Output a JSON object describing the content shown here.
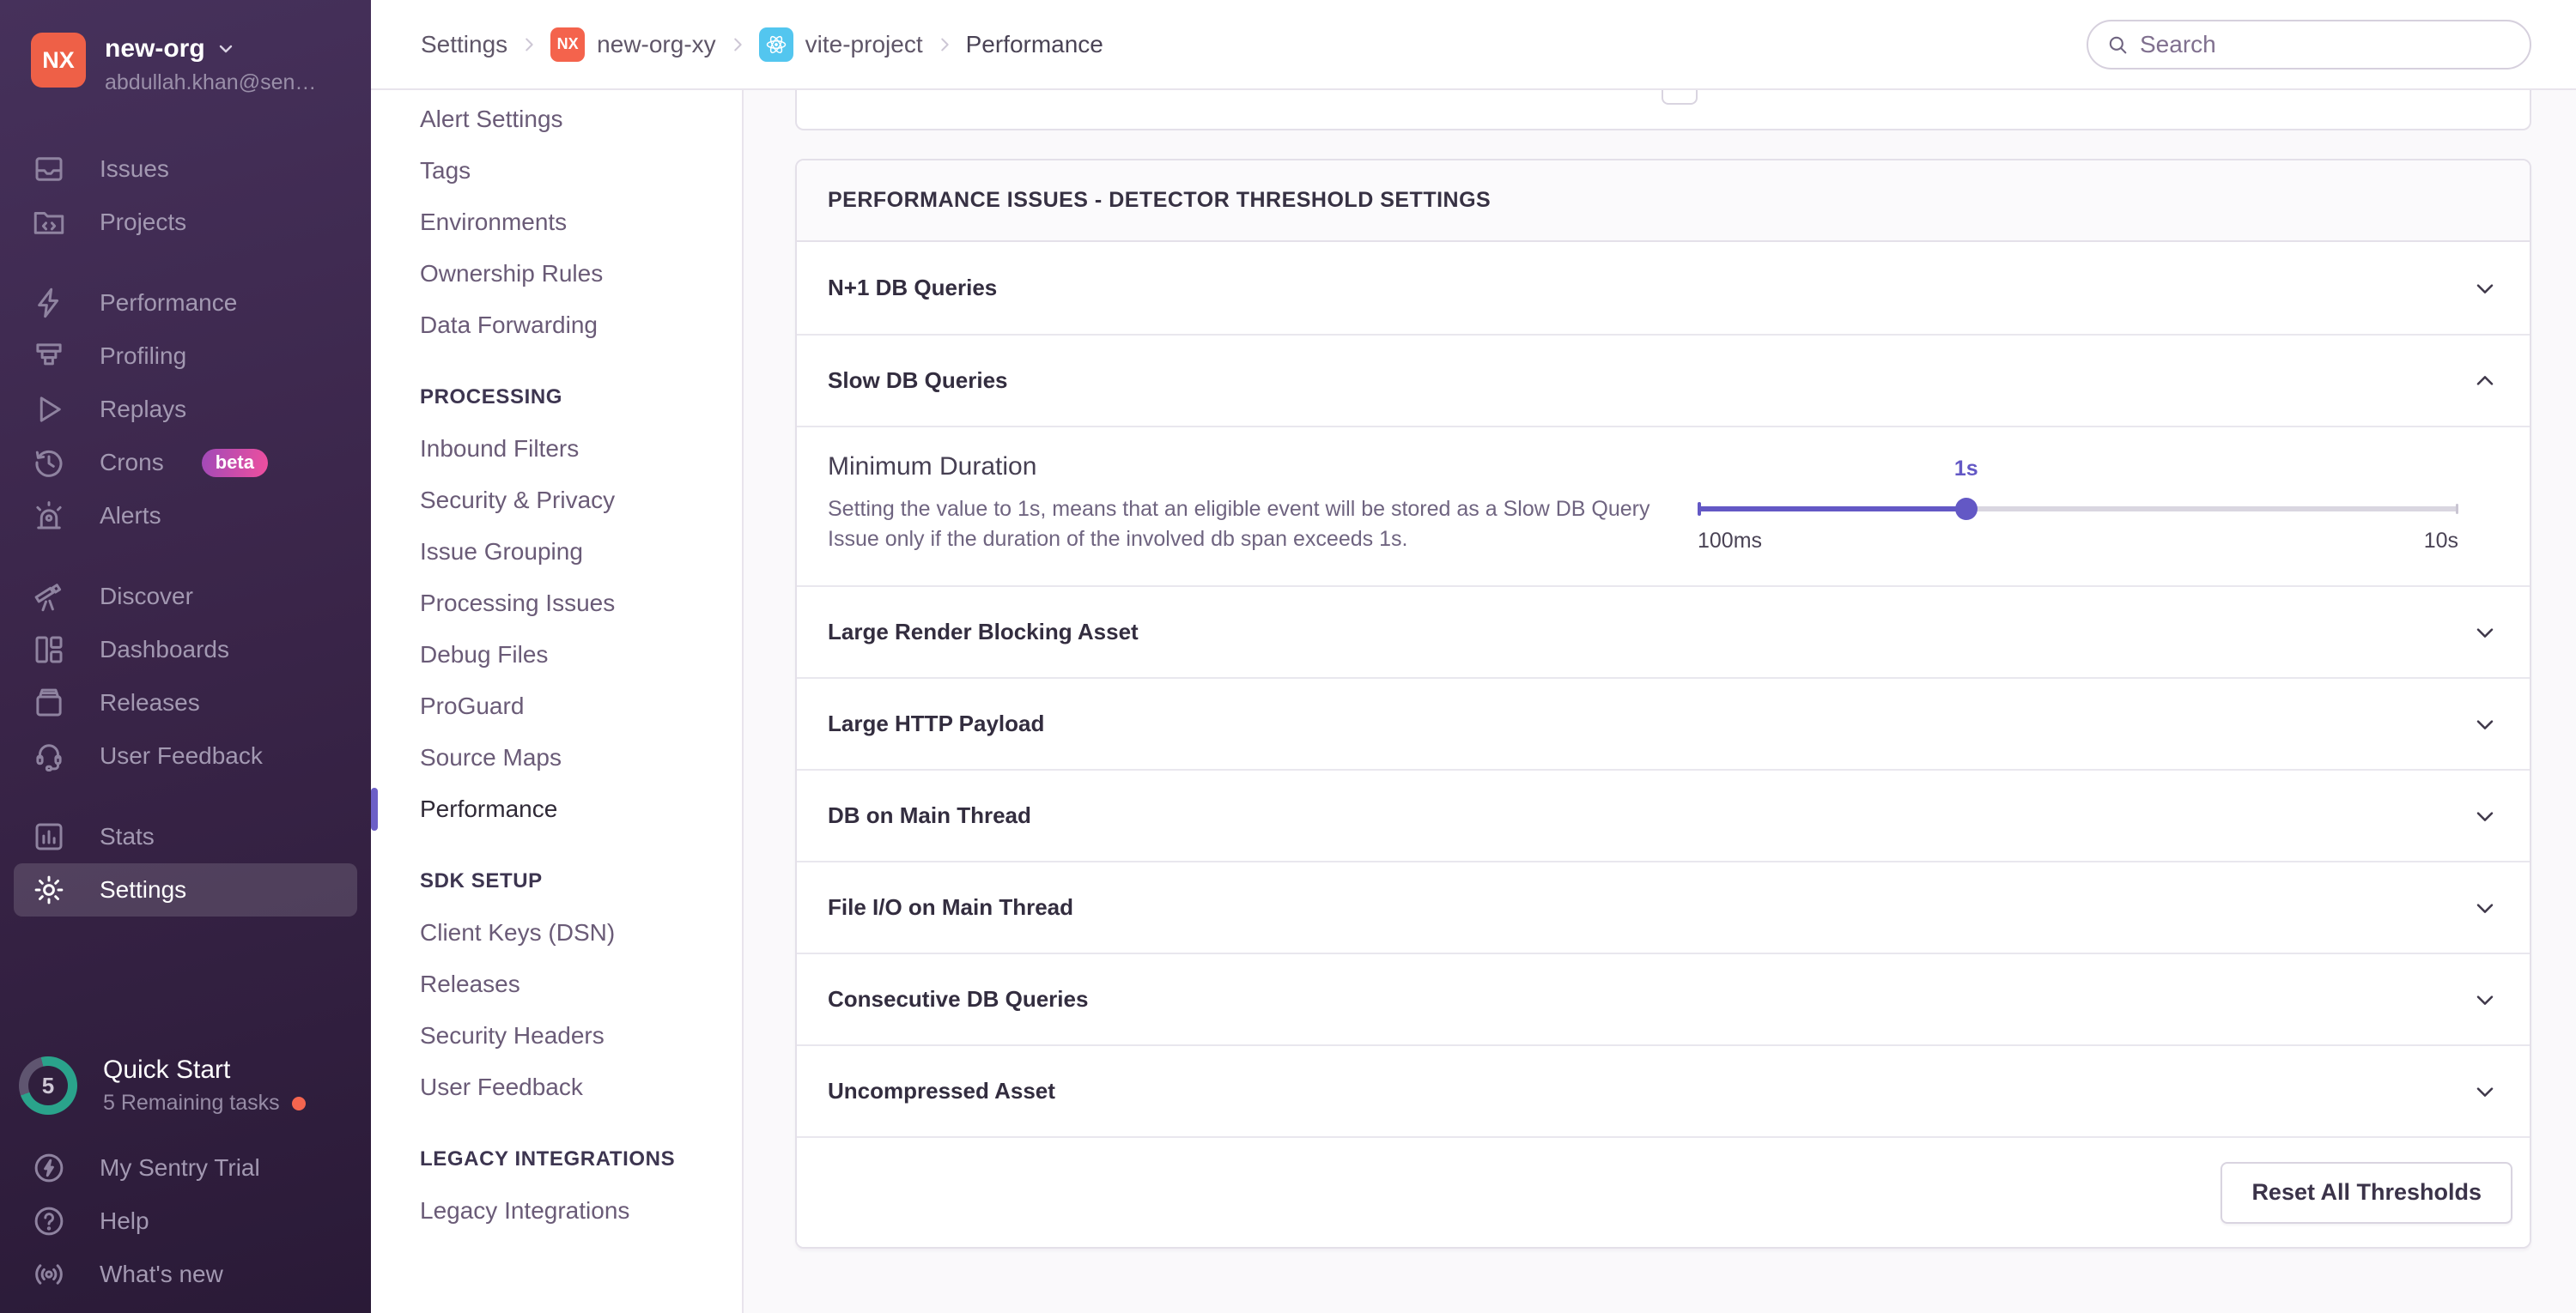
{
  "colors": {
    "accent_purple": "#6c5fc7",
    "slider_purple": "#6358c5",
    "brand_orange": "#ee6047",
    "badge_gradient_start": "#a04ab8",
    "badge_gradient_end": "#ef4f9e",
    "progress_green": "#2aa38b",
    "notification_dot_orange": "#f4654f",
    "sidebar_top": "#46315b",
    "sidebar_bottom": "#2a1a37"
  },
  "org": {
    "name": "new-org",
    "initials": "NX",
    "email": "abdullah.khan@sen…"
  },
  "sidebar": {
    "items": [
      {
        "label": "Issues"
      },
      {
        "label": "Projects"
      },
      {
        "label": "Performance"
      },
      {
        "label": "Profiling"
      },
      {
        "label": "Replays"
      },
      {
        "label": "Crons",
        "badge": "beta"
      },
      {
        "label": "Alerts"
      },
      {
        "label": "Discover"
      },
      {
        "label": "Dashboards"
      },
      {
        "label": "Releases"
      },
      {
        "label": "User Feedback"
      },
      {
        "label": "Stats"
      },
      {
        "label": "Settings"
      }
    ],
    "quick_start": {
      "count": "5",
      "title": "Quick Start",
      "subtitle": "5 Remaining tasks"
    },
    "footer_items": [
      {
        "label": "My Sentry Trial"
      },
      {
        "label": "Help"
      },
      {
        "label": "What's new"
      }
    ]
  },
  "breadcrumb": {
    "settings": "Settings",
    "org_initials": "NX",
    "org": "new-org-xy",
    "project": "vite-project",
    "page": "Performance"
  },
  "search": {
    "placeholder": "Search"
  },
  "settings_nav": {
    "active_item": "Performance",
    "groups": [
      {
        "heading": "",
        "items": [
          "Alert Settings",
          "Tags",
          "Environments",
          "Ownership Rules",
          "Data Forwarding"
        ]
      },
      {
        "heading": "PROCESSING",
        "items": [
          "Inbound Filters",
          "Security & Privacy",
          "Issue Grouping",
          "Processing Issues",
          "Debug Files",
          "ProGuard",
          "Source Maps",
          "Performance"
        ]
      },
      {
        "heading": "SDK SETUP",
        "items": [
          "Client Keys (DSN)",
          "Releases",
          "Security Headers",
          "User Feedback"
        ]
      },
      {
        "heading": "LEGACY INTEGRATIONS",
        "items": [
          "Legacy Integrations"
        ]
      }
    ]
  },
  "panel": {
    "title": "PERFORMANCE ISSUES - DETECTOR THRESHOLD SETTINGS",
    "rows": [
      {
        "label": "N+1 DB Queries",
        "expanded": false
      },
      {
        "label": "Slow DB Queries",
        "expanded": true
      },
      {
        "label": "Large Render Blocking Asset",
        "expanded": false
      },
      {
        "label": "Large HTTP Payload",
        "expanded": false
      },
      {
        "label": "DB on Main Thread",
        "expanded": false
      },
      {
        "label": "File I/O on Main Thread",
        "expanded": false
      },
      {
        "label": "Consecutive DB Queries",
        "expanded": false
      },
      {
        "label": "Uncompressed Asset",
        "expanded": false
      }
    ],
    "expanded_setting": {
      "name": "Minimum Duration",
      "description": "Setting the value to 1s, means that an eligible event will be stored as a Slow DB Query Issue only if the duration of the involved db span exceeds 1s.",
      "slider": {
        "value_label": "1s",
        "min_label": "100ms",
        "max_label": "10s",
        "fill_percent": "35.3%"
      }
    },
    "footer": {
      "reset_label": "Reset All Thresholds"
    }
  }
}
